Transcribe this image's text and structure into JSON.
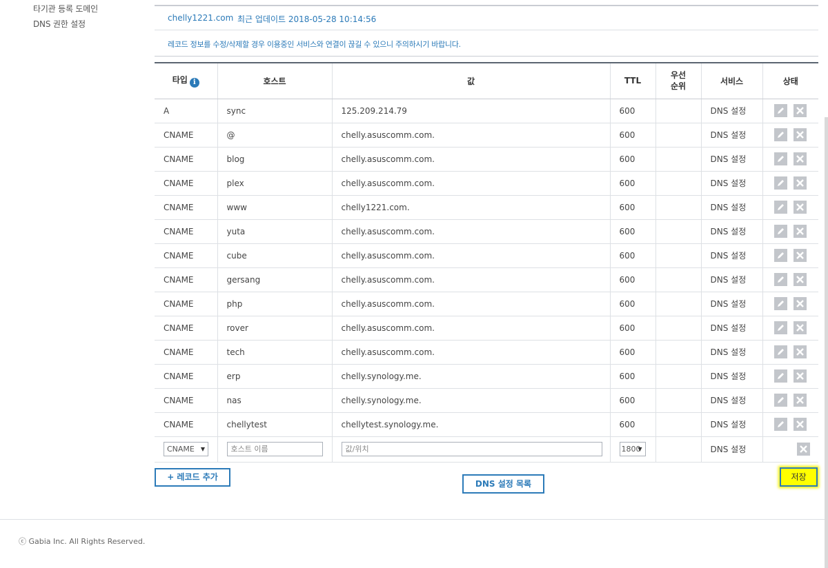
{
  "sidebar": {
    "items": [
      {
        "label": "타기관 등록 도메인"
      },
      {
        "label": "DNS 권한 설정"
      }
    ]
  },
  "header": {
    "domain": "chelly1221.com",
    "last_update": "최근 업데이트 2018-05-28 10:14:56",
    "notice": "레코드 정보를 수정/삭제할 경우 이용중인 서비스와 연결이 끊길 수 있으니 주의하시기 바랍니다."
  },
  "table": {
    "columns": [
      "타입",
      "호스트",
      "값",
      "TTL",
      "우선 순위",
      "서비스",
      "상태"
    ],
    "rows": [
      {
        "type": "A",
        "host": "sync",
        "value": "125.209.214.79",
        "ttl": "600",
        "priority": "",
        "service": "DNS 설정"
      },
      {
        "type": "CNAME",
        "host": "@",
        "value": "chelly.asuscomm.com.",
        "ttl": "600",
        "priority": "",
        "service": "DNS 설정"
      },
      {
        "type": "CNAME",
        "host": "blog",
        "value": "chelly.asuscomm.com.",
        "ttl": "600",
        "priority": "",
        "service": "DNS 설정"
      },
      {
        "type": "CNAME",
        "host": "plex",
        "value": "chelly.asuscomm.com.",
        "ttl": "600",
        "priority": "",
        "service": "DNS 설정"
      },
      {
        "type": "CNAME",
        "host": "www",
        "value": "chelly1221.com.",
        "ttl": "600",
        "priority": "",
        "service": "DNS 설정"
      },
      {
        "type": "CNAME",
        "host": "yuta",
        "value": "chelly.asuscomm.com.",
        "ttl": "600",
        "priority": "",
        "service": "DNS 설정"
      },
      {
        "type": "CNAME",
        "host": "cube",
        "value": "chelly.asuscomm.com.",
        "ttl": "600",
        "priority": "",
        "service": "DNS 설정"
      },
      {
        "type": "CNAME",
        "host": "gersang",
        "value": "chelly.asuscomm.com.",
        "ttl": "600",
        "priority": "",
        "service": "DNS 설정"
      },
      {
        "type": "CNAME",
        "host": "php",
        "value": "chelly.asuscomm.com.",
        "ttl": "600",
        "priority": "",
        "service": "DNS 설정"
      },
      {
        "type": "CNAME",
        "host": "rover",
        "value": "chelly.asuscomm.com.",
        "ttl": "600",
        "priority": "",
        "service": "DNS 설정"
      },
      {
        "type": "CNAME",
        "host": "tech",
        "value": "chelly.asuscomm.com.",
        "ttl": "600",
        "priority": "",
        "service": "DNS 설정"
      },
      {
        "type": "CNAME",
        "host": "erp",
        "value": "chelly.synology.me.",
        "ttl": "600",
        "priority": "",
        "service": "DNS 설정"
      },
      {
        "type": "CNAME",
        "host": "nas",
        "value": "chelly.synology.me.",
        "ttl": "600",
        "priority": "",
        "service": "DNS 설정"
      },
      {
        "type": "CNAME",
        "host": "chellytest",
        "value": "chellytest.synology.me.",
        "ttl": "600",
        "priority": "",
        "service": "DNS 설정"
      }
    ],
    "new_row": {
      "type_selected": "CNAME",
      "host_placeholder": "호스트 이름",
      "value_placeholder": "값/위치",
      "ttl_selected": "1800",
      "service": "DNS 설정"
    }
  },
  "buttons": {
    "add_record": "+ 레코드 추가",
    "dns_list": "DNS 설정 목록",
    "save": "저장"
  },
  "footer": {
    "copyright": "ⓒ Gabia Inc. All Rights Reserved."
  },
  "icons": {
    "info": "info-icon",
    "edit": "pencil-icon",
    "delete": "close-icon"
  },
  "colors": {
    "accent": "#2b7ab8",
    "highlight": "#ffff00"
  }
}
